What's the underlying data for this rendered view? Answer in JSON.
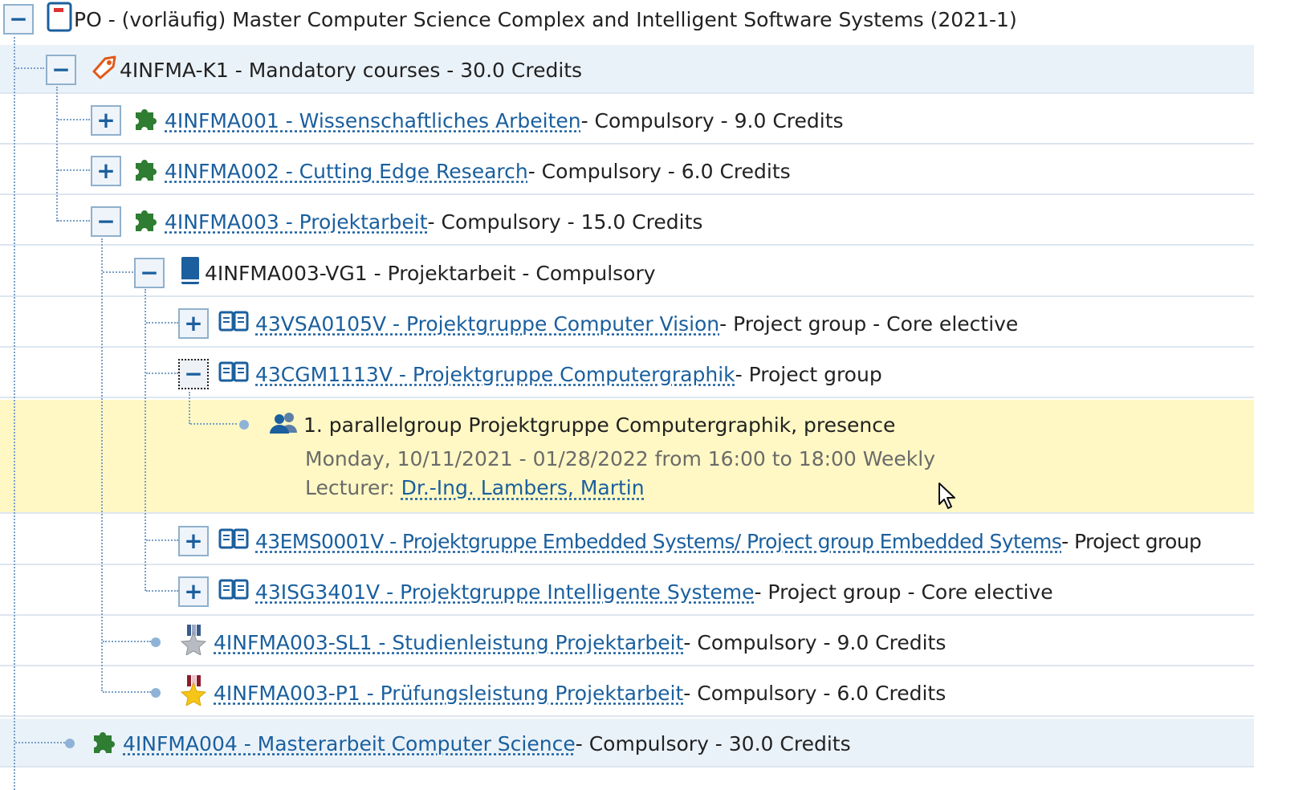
{
  "tree": {
    "root": {
      "text": "PO - (vorläufig) Master Computer Science Complex and Intelligent Software Systems (2021-1)",
      "toggle": "−"
    },
    "k1": {
      "text": "4INFMA-K1 - Mandatory courses - 30.0 Credits",
      "toggle": "−"
    },
    "m001": {
      "link": "4INFMA001 - Wissenschaftliches Arbeiten",
      "rest": " - Compulsory - 9.0 Credits",
      "toggle": "+"
    },
    "m002": {
      "link": "4INFMA002 - Cutting Edge Research",
      "rest": " - Compulsory - 6.0 Credits",
      "toggle": "+"
    },
    "m003": {
      "link": "4INFMA003 - Projektarbeit",
      "rest": " - Compulsory - 15.0 Credits",
      "toggle": "−"
    },
    "vg1": {
      "text": "4INFMA003-VG1 - Projektarbeit - Compulsory",
      "toggle": "−"
    },
    "vsa": {
      "link": "43VSA0105V - Projektgruppe Computer Vision",
      "rest": " - Project group - Core elective",
      "toggle": "+"
    },
    "cgm": {
      "link": "43CGM1113V - Projektgruppe Computergraphik",
      "rest": " - Project group",
      "toggle": "−"
    },
    "group": {
      "title": "1. parallelgroup Projektgruppe Computergraphik, presence",
      "schedule": "Monday, 10/11/2021 - 01/28/2022 from 16:00 to 18:00 Weekly",
      "lecturer_label": "Lecturer: ",
      "lecturer_name": "Dr.-Ing. Lambers, Martin"
    },
    "ems": {
      "link": "43EMS0001V - Projektgruppe Embedded Systems/ Project group Embedded Sytems",
      "rest": " - Project group",
      "toggle": "+"
    },
    "isg": {
      "link": "43ISG3401V - Projektgruppe Intelligente Systeme",
      "rest": " - Project group - Core elective",
      "toggle": "+"
    },
    "sl1": {
      "link": "4INFMA003-SL1 - Studienleistung Projektarbeit",
      "rest": " - Compulsory - 9.0 Credits"
    },
    "p1": {
      "link": "4INFMA003-P1 - Prüfungsleistung Projektarbeit",
      "rest": " - Compulsory - 6.0 Credits"
    },
    "m004": {
      "link": "4INFMA004 - Masterarbeit Computer Science",
      "rest": " - Compulsory - 30.0 Credits"
    }
  },
  "colors": {
    "link": "#1a5f9e",
    "highlight": "#fff8c4",
    "shaded": "#eaf2f9",
    "puzzle": "#2e7d32"
  }
}
